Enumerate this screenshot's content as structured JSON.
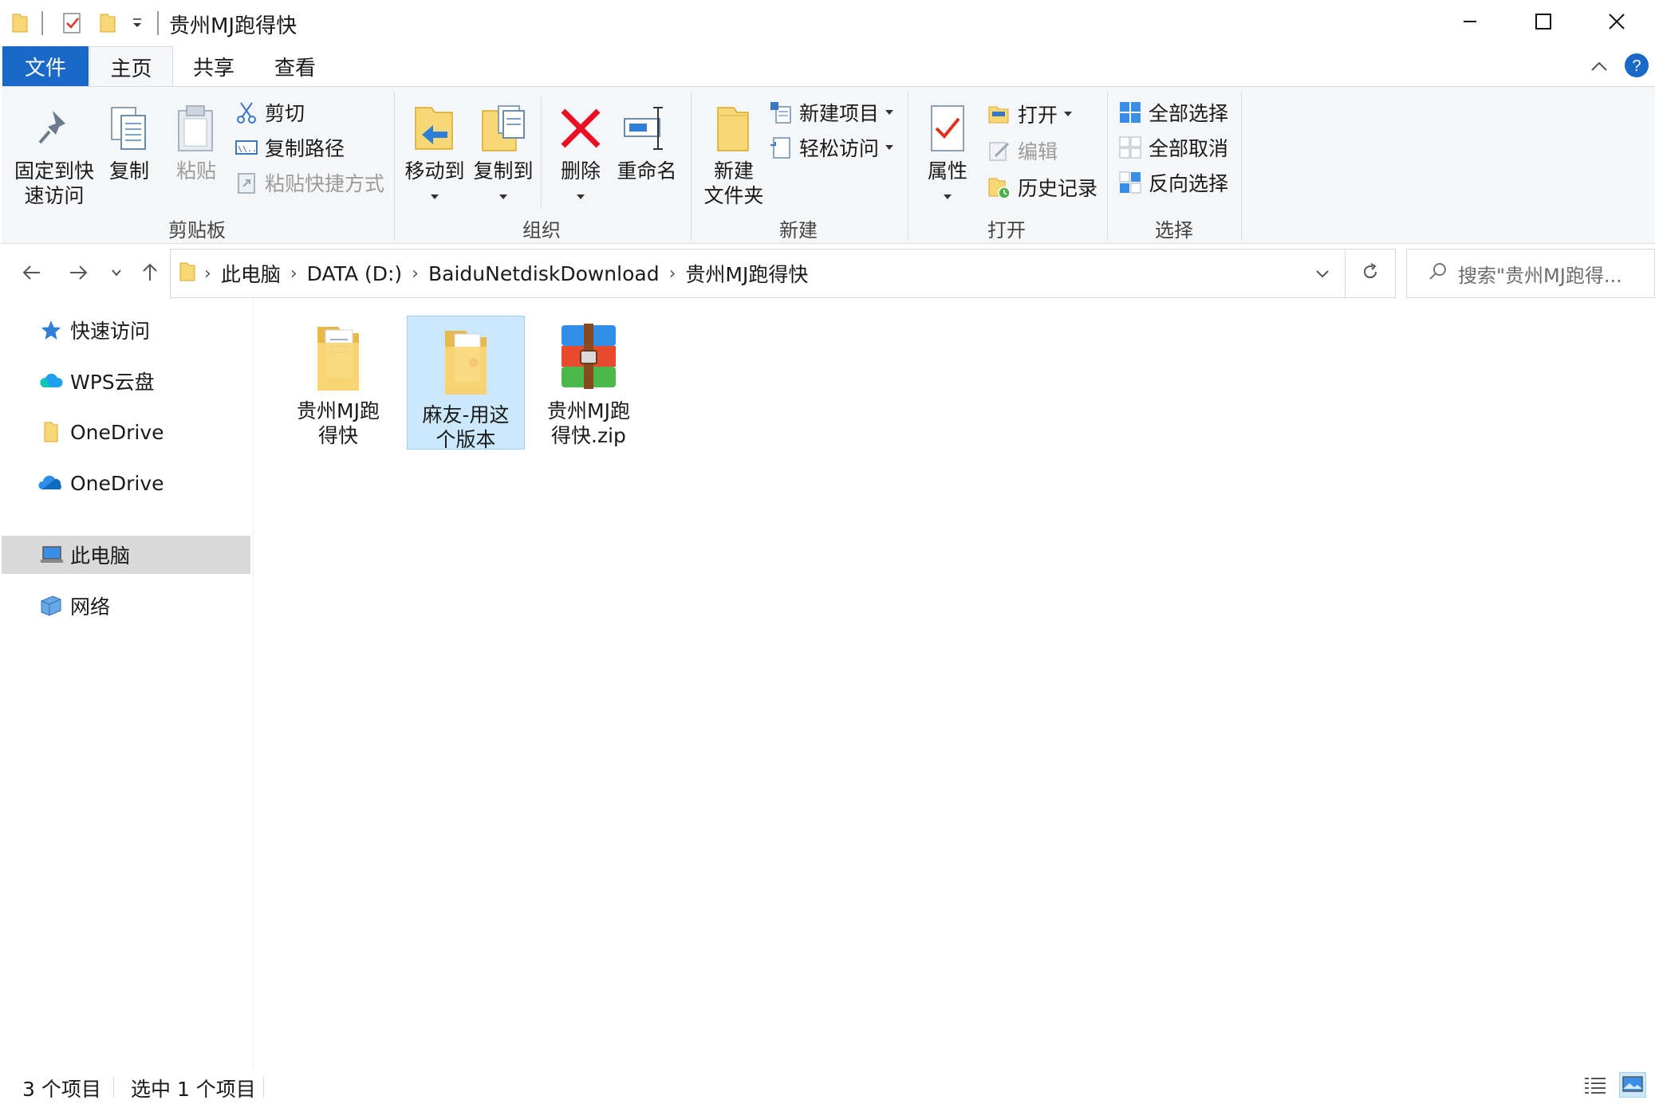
{
  "window": {
    "title": "贵州MJ跑得快",
    "controls": {
      "minimize": "minimize-icon",
      "maximize": "maximize-icon",
      "close": "close-icon"
    }
  },
  "ribbon": {
    "tabs": [
      {
        "label": "文件",
        "active": false
      },
      {
        "label": "主页",
        "active": true
      },
      {
        "label": "共享",
        "active": false
      },
      {
        "label": "查看",
        "active": false
      }
    ],
    "clipboard": {
      "group_label": "剪贴板",
      "pin_line1": "固定到快",
      "pin_line2": "速访问",
      "copy": "复制",
      "paste": "粘贴",
      "cut": "剪切",
      "copy_path": "复制路径",
      "paste_shortcut": "粘贴快捷方式"
    },
    "organize": {
      "group_label": "组织",
      "move_to": "移动到",
      "copy_to": "复制到",
      "delete": "删除",
      "rename": "重命名"
    },
    "new": {
      "group_label": "新建",
      "new_folder_line1": "新建",
      "new_folder_line2": "文件夹",
      "new_item": "新建项目",
      "easy_access": "轻松访问"
    },
    "open": {
      "group_label": "打开",
      "properties": "属性",
      "open": "打开",
      "edit": "编辑",
      "history": "历史记录"
    },
    "select": {
      "group_label": "选择",
      "select_all": "全部选择",
      "select_none": "全部取消",
      "invert": "反向选择"
    }
  },
  "address": {
    "breadcrumbs": [
      "此电脑",
      "DATA (D:)",
      "BaiduNetdiskDownload",
      "贵州MJ跑得快"
    ],
    "search_placeholder": "搜索\"贵州MJ跑得..."
  },
  "navpane": {
    "items": [
      {
        "label": "快速访问",
        "icon": "star-icon"
      },
      {
        "label": "WPS云盘",
        "icon": "cloud-icon"
      },
      {
        "label": "OneDrive",
        "icon": "folder-icon"
      },
      {
        "label": "OneDrive",
        "icon": "onedrive-cloud-icon"
      },
      {
        "label": "此电脑",
        "icon": "computer-icon",
        "selected": true
      },
      {
        "label": "网络",
        "icon": "network-icon"
      }
    ]
  },
  "files": [
    {
      "line1": "贵州MJ跑",
      "line2": "得快",
      "type": "folder",
      "selected": false
    },
    {
      "line1": "麻友-用这",
      "line2": "个版本",
      "type": "folder",
      "selected": true
    },
    {
      "line1": "贵州MJ跑",
      "line2": "得快.zip",
      "type": "archive",
      "selected": false
    }
  ],
  "status": {
    "item_count": "3 个项目",
    "selected_count": "选中 1 个项目"
  },
  "colors": {
    "accent": "#1a68c8",
    "selection_bg": "#cce8ff",
    "selection_border": "#99d1ff",
    "folder_yellow": "#f8d775",
    "delete_red": "#e81123"
  }
}
